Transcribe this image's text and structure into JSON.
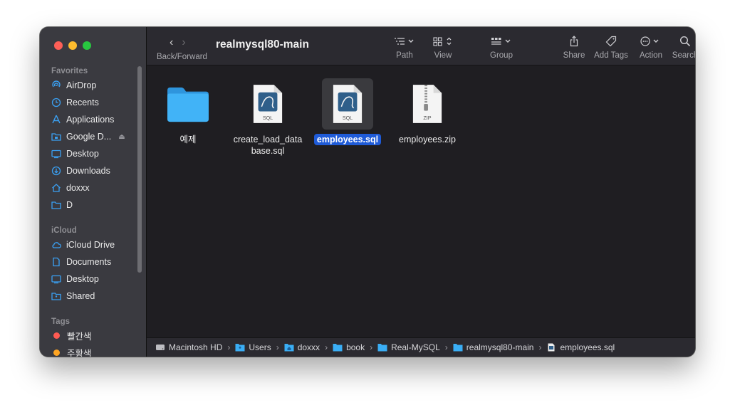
{
  "window": {
    "title": "realmysql80-main"
  },
  "navigation": {
    "back_forward_label": "Back/Forward"
  },
  "toolbar": {
    "path_label": "Path",
    "view_label": "View",
    "group_label": "Group",
    "share_label": "Share",
    "add_tags_label": "Add Tags",
    "action_label": "Action",
    "search_label": "Search"
  },
  "sidebar": {
    "favorites_header": "Favorites",
    "favorites": [
      {
        "label": "AirDrop",
        "icon": "airdrop-icon"
      },
      {
        "label": "Recents",
        "icon": "clock-icon"
      },
      {
        "label": "Applications",
        "icon": "applications-icon"
      },
      {
        "label": "Google D...",
        "icon": "drive-folder-icon"
      },
      {
        "label": "Desktop",
        "icon": "desktop-icon"
      },
      {
        "label": "Downloads",
        "icon": "download-icon"
      },
      {
        "label": "doxxx",
        "icon": "home-icon"
      },
      {
        "label": "D",
        "icon": "folder-icon"
      }
    ],
    "icloud_header": "iCloud",
    "icloud": [
      {
        "label": "iCloud Drive",
        "icon": "cloud-icon"
      },
      {
        "label": "Documents",
        "icon": "document-icon"
      },
      {
        "label": "Desktop",
        "icon": "desktop-icon"
      },
      {
        "label": "Shared",
        "icon": "shared-folder-icon"
      }
    ],
    "tags_header": "Tags",
    "tags": [
      {
        "label": "빨간색",
        "color": "#ff5a52"
      },
      {
        "label": "주황색",
        "color": "#ffa522"
      }
    ]
  },
  "files": [
    {
      "name": "예제",
      "type": "folder"
    },
    {
      "name": "create_load_data",
      "name2": "base.sql",
      "type": "sql"
    },
    {
      "name": "employees.sql",
      "type": "sql",
      "selected": true
    },
    {
      "name": "employees.zip",
      "type": "zip"
    }
  ],
  "file_badges": {
    "sql": "SQL",
    "zip": "ZIP"
  },
  "path": [
    "Macintosh HD",
    "Users",
    "doxxx",
    "book",
    "Real-MySQL",
    "realmysql80-main",
    "employees.sql"
  ],
  "colors": {
    "accent": "#1f5bd8",
    "folder": "#3aaef5",
    "sql_icon": "#2f5f8a"
  }
}
